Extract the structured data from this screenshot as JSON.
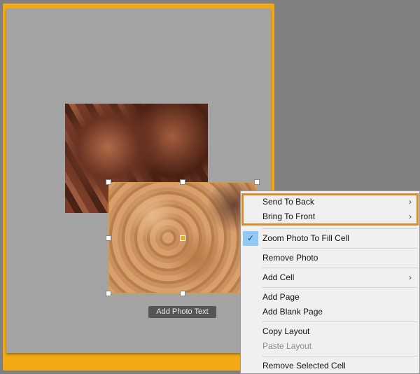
{
  "canvas": {
    "add_photo_text_label": "Add Photo Text",
    "accent": "#f0a81c"
  },
  "context_menu": {
    "items": [
      {
        "label": "Send To Back",
        "submenu": true
      },
      {
        "label": "Bring To Front",
        "submenu": true
      },
      {
        "label": "Zoom Photo To Fill Cell",
        "checked": true
      },
      {
        "label": "Remove Photo"
      },
      {
        "label": "Add Cell",
        "submenu": true
      },
      {
        "label": "Add Page"
      },
      {
        "label": "Add Blank Page"
      },
      {
        "label": "Copy Layout"
      },
      {
        "label": "Paste Layout",
        "disabled": true
      },
      {
        "label": "Remove Selected Cell"
      }
    ],
    "arrow": "›",
    "check": "✓"
  }
}
